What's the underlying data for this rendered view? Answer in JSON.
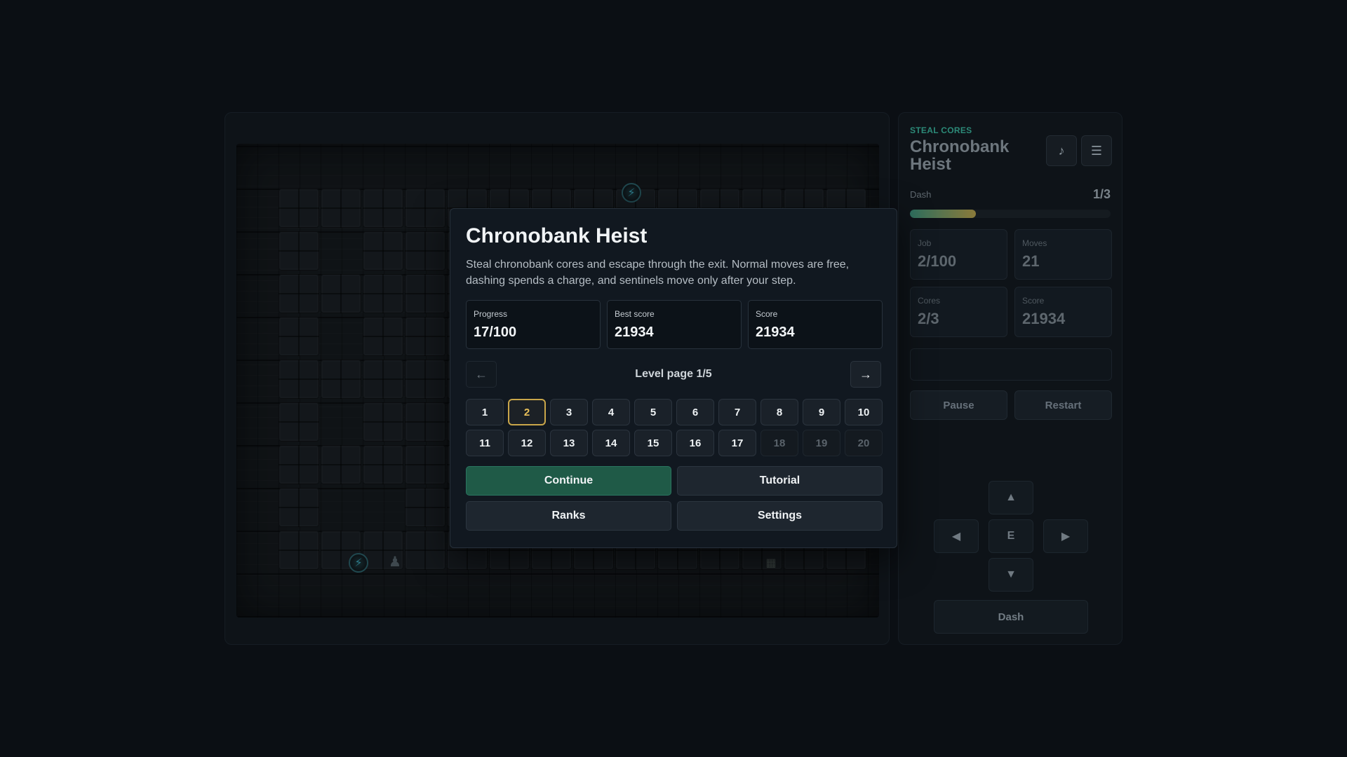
{
  "board": {
    "rows": [
      [
        1,
        1,
        1,
        1,
        1,
        1,
        1,
        1,
        1,
        1,
        1,
        1,
        1,
        1
      ],
      [
        1,
        0,
        1,
        1,
        1,
        1,
        1,
        1,
        1,
        1,
        1,
        1,
        1,
        1
      ],
      [
        1,
        1,
        1,
        1,
        1,
        1,
        1,
        1,
        1,
        1,
        1,
        1,
        1,
        1
      ],
      [
        1,
        0,
        1,
        1,
        1,
        1,
        1,
        1,
        1,
        1,
        1,
        1,
        1,
        1
      ],
      [
        1,
        1,
        1,
        1,
        1,
        1,
        1,
        1,
        1,
        1,
        1,
        1,
        1,
        1
      ],
      [
        1,
        0,
        1,
        1,
        1,
        1,
        1,
        1,
        1,
        1,
        1,
        1,
        1,
        1
      ],
      [
        1,
        1,
        1,
        1,
        1,
        1,
        1,
        1,
        1,
        1,
        1,
        1,
        1,
        1
      ],
      [
        1,
        0,
        0,
        1,
        1,
        1,
        1,
        1,
        1,
        1,
        1,
        1,
        1,
        1
      ],
      [
        1,
        1,
        1,
        1,
        1,
        1,
        1,
        1,
        1,
        1,
        1,
        1,
        1,
        1
      ]
    ]
  },
  "panel": {
    "eyebrow": "STEAL CORES",
    "title": "Chronobank Heist",
    "music_icon": "music-note-icon",
    "menu_icon": "hamburger-menu-icon",
    "dash_label": "Dash",
    "dash_count": "1/3",
    "dash_fraction": 0.33,
    "stats": [
      {
        "label": "Job",
        "value": "2/100"
      },
      {
        "label": "Moves",
        "value": "21"
      },
      {
        "label": "Cores",
        "value": "2/3"
      },
      {
        "label": "Score",
        "value": "21934"
      }
    ],
    "pause_label": "Pause",
    "restart_label": "Restart",
    "pad": {
      "up": "▲",
      "left": "◀",
      "center": "E",
      "right": "▶",
      "down": "▼"
    },
    "dash_button": "Dash"
  },
  "modal": {
    "title": "Chronobank Heist",
    "description": "Steal chronobank cores and escape through the exit. Normal moves are free, dashing spends a charge, and sentinels move only after your step.",
    "stats": [
      {
        "label": "Progress",
        "value": "17/100"
      },
      {
        "label": "Best score",
        "value": "21934"
      },
      {
        "label": "Score",
        "value": "21934"
      }
    ],
    "pager": {
      "prev": "←",
      "next": "→",
      "label": "Level page 1/5"
    },
    "levels": [
      {
        "n": "1",
        "state": "open"
      },
      {
        "n": "2",
        "state": "selected"
      },
      {
        "n": "3",
        "state": "open"
      },
      {
        "n": "4",
        "state": "open"
      },
      {
        "n": "5",
        "state": "open"
      },
      {
        "n": "6",
        "state": "open"
      },
      {
        "n": "7",
        "state": "open"
      },
      {
        "n": "8",
        "state": "open"
      },
      {
        "n": "9",
        "state": "open"
      },
      {
        "n": "10",
        "state": "open"
      },
      {
        "n": "11",
        "state": "open"
      },
      {
        "n": "12",
        "state": "open"
      },
      {
        "n": "13",
        "state": "open"
      },
      {
        "n": "14",
        "state": "open"
      },
      {
        "n": "15",
        "state": "open"
      },
      {
        "n": "16",
        "state": "open"
      },
      {
        "n": "17",
        "state": "open"
      },
      {
        "n": "18",
        "state": "locked"
      },
      {
        "n": "19",
        "state": "locked"
      },
      {
        "n": "20",
        "state": "locked"
      }
    ],
    "actions": {
      "continue": "Continue",
      "tutorial": "Tutorial",
      "ranks": "Ranks",
      "settings": "Settings"
    }
  },
  "colors": {
    "accent": "#1f5a47",
    "selected": "#c9a64a",
    "eyebrow": "#2c8a78"
  }
}
